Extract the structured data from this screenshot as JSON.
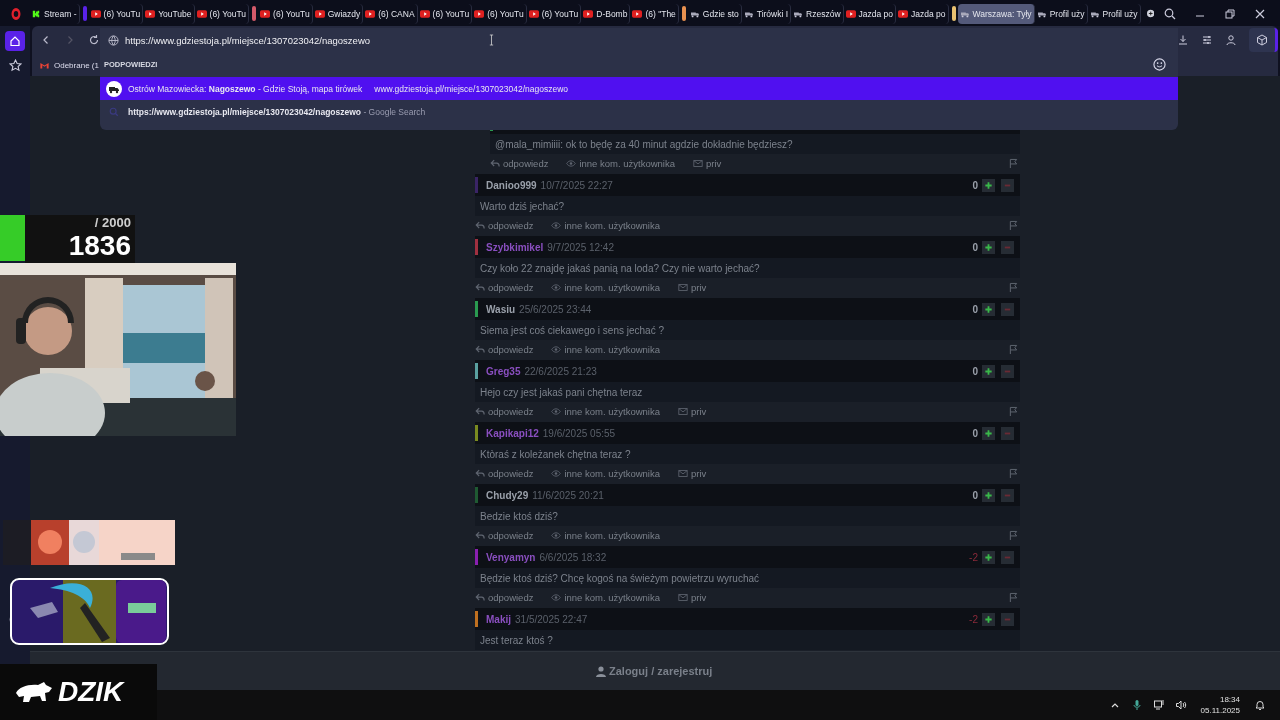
{
  "tabs": [
    {
      "label": "Stream -",
      "kind": "kick",
      "selected": false
    },
    {
      "label": "(6) YouTu",
      "kind": "video",
      "selected": false,
      "color": "#5a22e8"
    },
    {
      "label": "YouTube",
      "kind": "video",
      "selected": false
    },
    {
      "label": "(6) YouTu",
      "kind": "video",
      "selected": false
    },
    {
      "label": "(6) YouTu",
      "kind": "video",
      "selected": false,
      "color": "#d45a6a"
    },
    {
      "label": "Gwiazdy",
      "kind": "video",
      "selected": false
    },
    {
      "label": "(6) CANA",
      "kind": "video",
      "selected": false
    },
    {
      "label": "(6) YouTu",
      "kind": "video",
      "selected": false
    },
    {
      "label": "(6) YouTu",
      "kind": "video",
      "selected": false
    },
    {
      "label": "(6) YouTu",
      "kind": "video",
      "selected": false
    },
    {
      "label": "D-Bomb",
      "kind": "video",
      "selected": false
    },
    {
      "label": "(6) \"The",
      "kind": "video",
      "selected": false
    },
    {
      "label": "Gdzie sto",
      "kind": "site",
      "selected": false,
      "color": "#e89050"
    },
    {
      "label": "Tirówki I",
      "kind": "site",
      "selected": false
    },
    {
      "label": "Rzeszów",
      "kind": "site",
      "selected": false
    },
    {
      "label": "Jazda po",
      "kind": "video",
      "selected": false
    },
    {
      "label": "Jazda po",
      "kind": "video",
      "selected": false
    },
    {
      "label": "Warszawa: Tyły",
      "kind": "site",
      "selected": true,
      "color": "#e8c070"
    },
    {
      "label": "Profil uży",
      "kind": "site",
      "selected": false
    },
    {
      "label": "Profil uży",
      "kind": "site",
      "selected": false
    }
  ],
  "address": {
    "value": "https://www.gdziestoja.pl/miejsce/1307023042/nagoszewo"
  },
  "bookmarks": [
    {
      "label": "Odebrane (1"
    }
  ],
  "suggestions": {
    "header": "PODPOWIEDZI",
    "items": [
      {
        "kind": "site",
        "text": "Ostrów Mazowiecka: **Nagoszewo** - Gdzie Stoją, mapa tirówek",
        "url": "www.gdziestoja.pl/miejsce/1307023042/nagoszewo",
        "selected": true
      },
      {
        "kind": "search",
        "text": "**https://www.gdziestoja.pl/miejsce/1307023042/nagoszewo** - Google Search",
        "selected": false
      }
    ]
  },
  "comments": [
    {
      "kind": "reply",
      "color": "#2a9a50",
      "text": "@mala_mimiiii: ok to będę za 40 minut agdzie dokładnie będziesz?",
      "actions": [
        "odpowiedz",
        "inne kom. użytkownika",
        "priv"
      ]
    },
    {
      "kind": "top",
      "user": "Danioo999",
      "highlighted": false,
      "color": "#3a2466",
      "date": "10/7/2025 22:27",
      "score": "0",
      "negative": false,
      "text": "Warto dziś jechać?",
      "actions": [
        "odpowiedz",
        "inne kom. użytkownika"
      ]
    },
    {
      "kind": "top",
      "user": "Szybkimikel",
      "highlighted": true,
      "color": "#a03040",
      "date": "9/7/2025 12:42",
      "score": "0",
      "negative": false,
      "text": "Czy koło 22 znajdę jakaś panią na loda?  Czy nie warto jechać?",
      "actions": [
        "odpowiedz",
        "inne kom. użytkownika",
        "priv"
      ]
    },
    {
      "kind": "top",
      "user": "Wasiu",
      "highlighted": false,
      "color": "#2a9a50",
      "date": "25/6/2025 23:44",
      "score": "0",
      "negative": false,
      "text": "Siema jest coś ciekawego i sens jechać ?",
      "actions": [
        "odpowiedz",
        "inne kom. użytkownika"
      ]
    },
    {
      "kind": "top",
      "user": "Greg35",
      "highlighted": true,
      "color": "#5aa0a0",
      "date": "22/6/2025 21:23",
      "score": "0",
      "negative": false,
      "text": "Hejo czy jest jakaś pani chętna teraz",
      "actions": [
        "odpowiedz",
        "inne kom. użytkownika",
        "priv"
      ]
    },
    {
      "kind": "top",
      "user": "Kapikapi12",
      "highlighted": true,
      "color": "#7a8a20",
      "date": "19/6/2025 05:55",
      "score": "0",
      "negative": false,
      "text": "Ktòraś z koleżanek chętna teraz ?",
      "actions": [
        "odpowiedz",
        "inne kom. użytkownika",
        "priv"
      ]
    },
    {
      "kind": "top",
      "user": "Chudy29",
      "highlighted": false,
      "color": "#1f5a32",
      "date": "11/6/2025 20:21",
      "score": "0",
      "negative": false,
      "text": "Bedzie ktoś dziś?",
      "actions": [
        "odpowiedz",
        "inne kom. użytkownika"
      ]
    },
    {
      "kind": "top",
      "user": "Venyamyn",
      "highlighted": true,
      "color": "#8a20b0",
      "date": "6/6/2025 18:32",
      "score": "-2",
      "negative": true,
      "text": "Będzie ktoś dziś? Chcę kogoś na świeżym powietrzu wyruchać",
      "actions": [
        "odpowiedz",
        "inne kom. użytkownika",
        "priv"
      ]
    },
    {
      "kind": "top",
      "user": "Makij",
      "highlighted": true,
      "color": "#c07020",
      "date": "31/5/2025 22:47",
      "score": "-2",
      "negative": true,
      "text": "Jest teraz ktoś ?"
    }
  ],
  "login_bar": {
    "label": "Zaloguj / zarejestruj"
  },
  "overlay": {
    "goal": "/ 2000",
    "count": "1836",
    "logo": "DZIK"
  },
  "taskbar": {
    "time": "18:34",
    "date": "05.11.2025"
  }
}
